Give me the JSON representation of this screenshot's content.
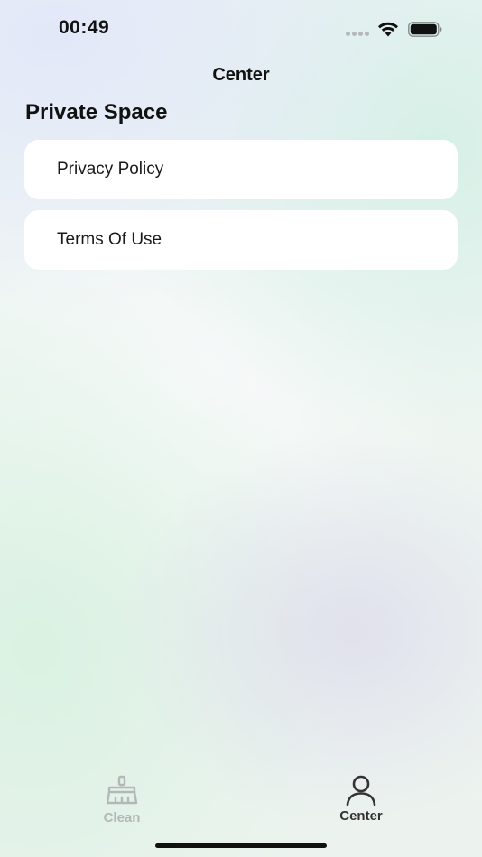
{
  "status_bar": {
    "time": "00:49"
  },
  "header": {
    "title": "Center"
  },
  "section": {
    "title": "Private Space"
  },
  "menu": {
    "items": [
      {
        "label": "Privacy Policy",
        "icon": "none"
      },
      {
        "label": "Terms Of Use",
        "icon": "none"
      }
    ]
  },
  "tab_bar": {
    "tabs": [
      {
        "label": "Clean",
        "icon": "broom-icon",
        "active": false,
        "color": "#b3b8b6"
      },
      {
        "label": "Center",
        "icon": "person-icon",
        "active": true,
        "color": "#333333"
      }
    ]
  },
  "colors": {
    "card_background": "#ffffff",
    "text_primary": "#111111",
    "inactive_tab": "#b3b8b6"
  }
}
